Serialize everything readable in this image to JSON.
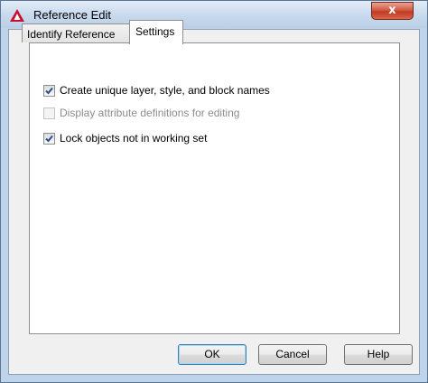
{
  "window": {
    "title": "Reference Edit",
    "close_label": "x"
  },
  "tabs": [
    {
      "label": "Identify Reference",
      "active": false
    },
    {
      "label": "Settings",
      "active": true
    }
  ],
  "settings": {
    "options": [
      {
        "label": "Create unique layer, style, and block names",
        "checked": true,
        "enabled": true
      },
      {
        "label": "Display attribute definitions for editing",
        "checked": false,
        "enabled": false
      },
      {
        "label": "Lock objects not in working set",
        "checked": true,
        "enabled": true
      }
    ]
  },
  "buttons": {
    "ok": "OK",
    "cancel": "Cancel",
    "help": "Help"
  },
  "colors": {
    "app_icon": "#c8102e",
    "check": "#2b4f8c"
  },
  "icons": {
    "app": "autocad-logo-icon",
    "close": "close-icon",
    "check": "checkmark-icon"
  }
}
